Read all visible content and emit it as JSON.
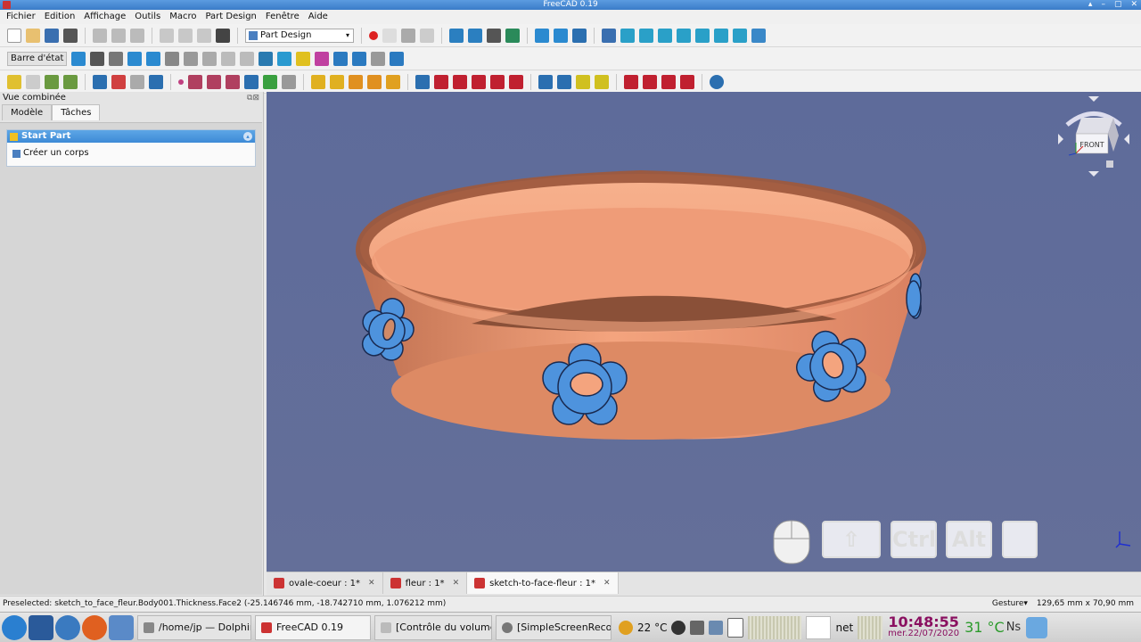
{
  "window": {
    "title": "FreeCAD 0.19",
    "controls": [
      "▴",
      "–",
      "▢",
      "✕"
    ]
  },
  "menu": [
    "Fichier",
    "Edition",
    "Affichage",
    "Outils",
    "Macro",
    "Part Design",
    "Fenêtre",
    "Aide"
  ],
  "toolbar": {
    "workbench": "Part Design",
    "barre_etat": "Barre d'état"
  },
  "panel": {
    "title": "Vue combinée",
    "tabs": [
      "Modèle",
      "Tâches"
    ],
    "active_tab": "Tâches",
    "task_header": "Start Part",
    "task_item": "Créer un corps"
  },
  "navcube": {
    "face": "FRONT"
  },
  "nav_keys": [
    "Ctrl",
    "Alt"
  ],
  "doc_tabs": [
    {
      "label": "ovale-coeur : 1*"
    },
    {
      "label": "fleur : 1*"
    },
    {
      "label": "sketch-to-face-fleur : 1*"
    }
  ],
  "status": {
    "preselected": "Preselected: sketch_to_face_fleur.Body001.Thickness.Face2 (-25.146746 mm, -18.742710 mm, 1.076212 mm)",
    "nav_style": "Gesture▾",
    "dimensions": "129,65 mm x 70,90 mm"
  },
  "taskbar": {
    "windows": [
      {
        "label": "/home/jp — Dolphin"
      },
      {
        "label": "FreeCAD 0.19"
      },
      {
        "label": "[Contrôle du volume]"
      },
      {
        "label": "[SimpleScreenReco..."
      }
    ],
    "weather": "22 °C",
    "net": "net",
    "time": "10:48:55",
    "date": "mer.22/07/2020",
    "cpu_temp": "31 °C",
    "cpu_suffix": "Ns"
  },
  "colors": {
    "bowl": "#f0a07c",
    "flower": "#4e93dd",
    "background": "#5f6b9a",
    "task_header": "#4a96e0"
  }
}
